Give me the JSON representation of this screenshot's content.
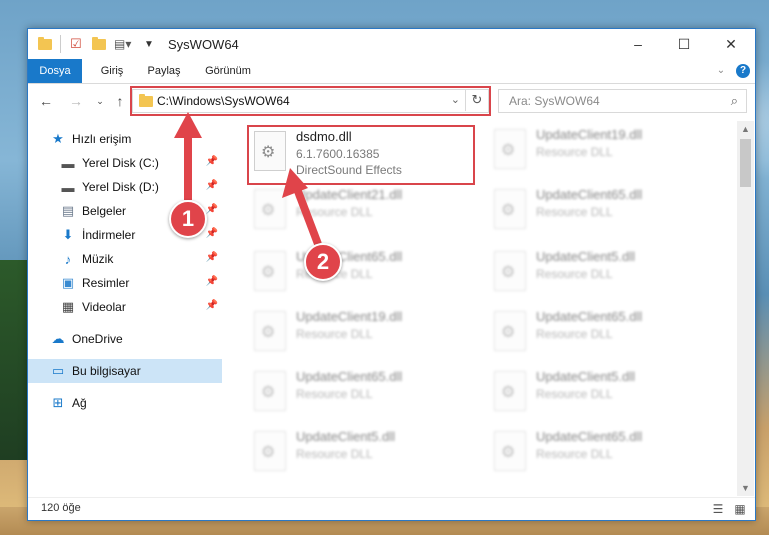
{
  "window": {
    "title": "SysWOW64",
    "controls": {
      "minimize": "–",
      "maximize": "☐",
      "close": "✕"
    }
  },
  "ribbon": {
    "tabs": [
      "Dosya",
      "Giriş",
      "Paylaş",
      "Görünüm"
    ],
    "expand_icon": "chevron-down-icon",
    "help_icon": "?"
  },
  "navigation": {
    "address": "C:\\Windows\\SysWOW64",
    "search_placeholder": "Ara: SysWOW64"
  },
  "sidebar": {
    "items": [
      {
        "label": "Hızlı erişim",
        "icon": "star-icon"
      },
      {
        "label": "Yerel Disk (C:)",
        "icon": "drive-icon",
        "pinned": true
      },
      {
        "label": "Yerel Disk (D:)",
        "icon": "drive-icon",
        "pinned": true
      },
      {
        "label": "Belgeler",
        "icon": "documents-icon",
        "pinned": true
      },
      {
        "label": "İndirmeler",
        "icon": "download-icon",
        "pinned": true
      },
      {
        "label": "Müzik",
        "icon": "music-icon",
        "pinned": true
      },
      {
        "label": "Resimler",
        "icon": "pictures-icon",
        "pinned": true
      },
      {
        "label": "Videolar",
        "icon": "videos-icon",
        "pinned": true
      },
      {
        "label": "OneDrive",
        "icon": "cloud-icon"
      },
      {
        "label": "Bu bilgisayar",
        "icon": "computer-icon",
        "selected": true
      },
      {
        "label": "Ağ",
        "icon": "network-icon"
      }
    ]
  },
  "files": {
    "highlighted": {
      "name": "dsdmo.dll",
      "version": "6.1.7600.16385",
      "description": "DirectSound Effects"
    },
    "left_column": [
      {
        "name": "UpdateClient21.dll",
        "description": "Resource DLL"
      },
      {
        "name": "UpdateClient65.dll",
        "description": "Resource DLL"
      },
      {
        "name": "UpdateClient19.dll",
        "description": "Resource DLL"
      },
      {
        "name": "UpdateClient65.dll",
        "description": "Resource DLL"
      },
      {
        "name": "UpdateClient5.dll",
        "description": "Resource DLL"
      }
    ],
    "right_column": [
      {
        "name": "UpdateClient19.dll",
        "description": "Resource DLL"
      },
      {
        "name": "UpdateClient65.dll",
        "description": "Resource DLL"
      },
      {
        "name": "UpdateClient5.dll",
        "description": "Resource DLL"
      },
      {
        "name": "UpdateClient65.dll",
        "description": "Resource DLL"
      },
      {
        "name": "UpdateClient5.dll",
        "description": "Resource DLL"
      },
      {
        "name": "UpdateClient65.dll",
        "description": "Resource DLL"
      }
    ]
  },
  "status": {
    "item_count": "120 öğe"
  },
  "annotations": {
    "step1": "1",
    "step2": "2",
    "color": "#e0444a"
  }
}
